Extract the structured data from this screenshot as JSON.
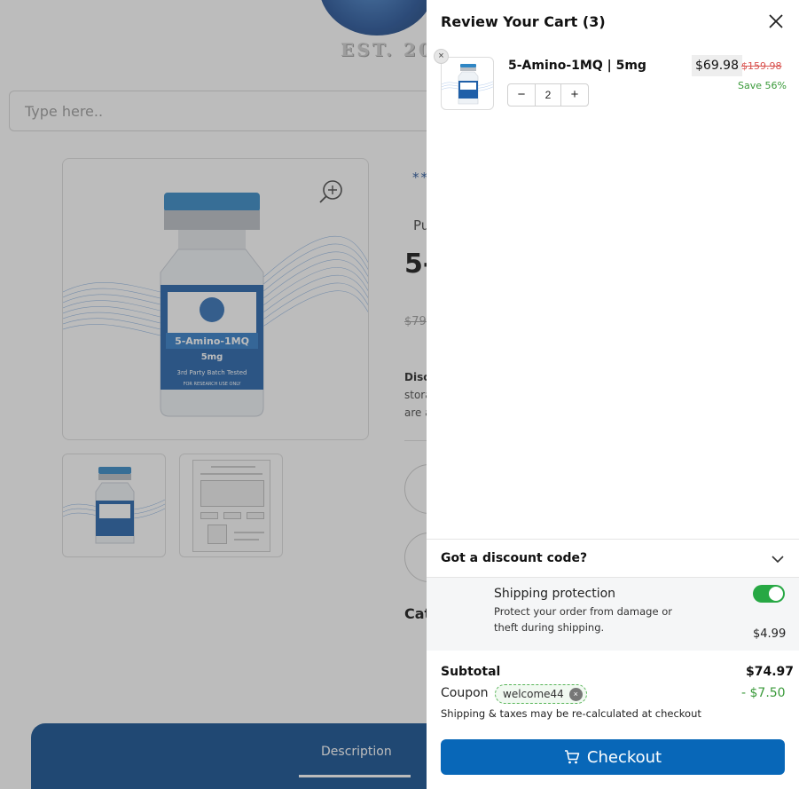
{
  "background_page": {
    "logo_text": "EST. 20",
    "search_placeholder": "Type here..",
    "rating_stars": "**",
    "subtitle_fragment": "Pu",
    "title_fragment": "5-",
    "old_price_fragment": "$79.",
    "desc_heading_fragment": "Disc",
    "desc_line_1_fragment": "stora",
    "desc_line_2_fragment": "are a",
    "category_fragment": "Cat",
    "description_tab": "Description",
    "product_vial": {
      "name": "5-Amino-1MQ",
      "dose": "5mg",
      "tagline": "3rd Party Batch Tested",
      "research_label": "FOR RESEARCH USE ONLY"
    }
  },
  "cart": {
    "title": "Review Your Cart (3)",
    "items": [
      {
        "name": "5-Amino-1MQ | 5mg",
        "quantity": "2",
        "price": "$69.98",
        "compare_price": "$159.98",
        "savings": "Save 56%",
        "minus_symbol": "−",
        "plus_symbol": "+",
        "remove_symbol": "×"
      }
    ],
    "discount": {
      "label": "Got a discount code?"
    },
    "shipping_protection": {
      "title": "Shipping protection",
      "desc_line_1": "Protect your order from damage or",
      "desc_line_2": "theft during shipping.",
      "price": "$4.99",
      "enabled": true
    },
    "summary": {
      "subtotal_label": "Subtotal",
      "subtotal_value": "$74.97",
      "coupon_label": "Coupon",
      "coupon_code": "welcome44",
      "coupon_remove_symbol": "×",
      "coupon_value": "-  $7.50",
      "tax_note": "Shipping & taxes may be re-calculated at checkout"
    },
    "checkout_label": "Checkout"
  },
  "colors": {
    "checkout_blue": "#0867b8",
    "toggle_green": "#27a844",
    "save_green": "#3a9a3a",
    "compare_red": "#d9534f",
    "brand_navy": "#0c4a8e"
  },
  "icons": {
    "close": "close-icon",
    "chevron": "chevron-down-icon",
    "cart": "cart-icon",
    "zoom": "zoom-in-icon"
  }
}
